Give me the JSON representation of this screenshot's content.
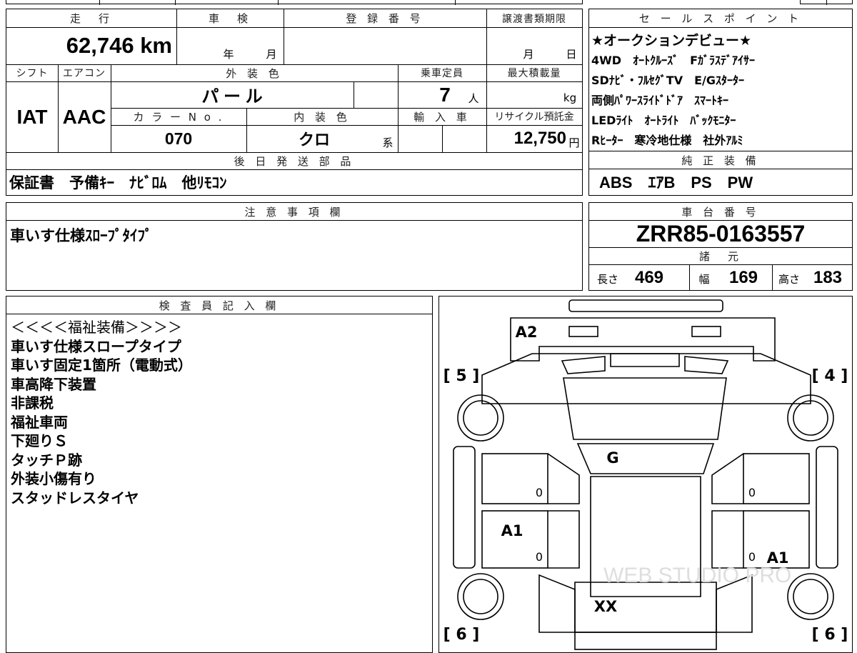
{
  "top_partial": "",
  "vehicle": {
    "mileage_header": "走　行",
    "mileage_value": "62,746 km",
    "inspection_header": "車　検",
    "inspection_year": "年",
    "inspection_month": "月",
    "registration_header": "登 録 番 号",
    "transfer_header": "譲渡書類期限",
    "transfer_month": "月",
    "transfer_day": "日",
    "shift_header": "シフト",
    "shift_value": "IAT",
    "ac_header": "エアコン",
    "ac_value": "AAC",
    "exterior_color_header": "外 装 色",
    "exterior_color_value": "パ ー ル",
    "capacity_header": "乗車定員",
    "capacity_value": "7",
    "capacity_unit": "人",
    "max_load_header": "最大積載量",
    "max_load_unit": "kg",
    "color_no_header": "カ ラ ー N o .",
    "color_no_value": "070",
    "interior_header": "内 装 色",
    "interior_value": "クロ",
    "interior_unit": "系",
    "import_header": "輸 入 車",
    "recycle_header": "リサイクル預託金",
    "recycle_value": "12,750",
    "recycle_unit": "円",
    "later_parts_header": "後 日 発 送 部 品",
    "later_parts_value": "保証書　予備ｷｰ　ﾅﾋﾞﾛﾑ　他ﾘﾓｺﾝ"
  },
  "sales_points": {
    "header": "セ ー ル ス ポ イ ン ト",
    "lines": [
      "★オークションデビュー★",
      "4WD　ｵｰﾄｸﾙｰｽﾞ　Fｶﾞﾗｽﾃﾞｱｲｻｰ",
      "SDﾅﾋﾞ・ﾌﾙｾｸﾞTV　E/Gｽﾀｰﾀｰ",
      "両側ﾊﾟﾜｰｽﾗｲﾄﾞﾄﾞｱ　ｽﾏｰﾄｷｰ",
      "LEDﾗｲﾄ　ｵｰﾄﾗｲﾄ　ﾊﾞｯｸﾓﾆﾀｰ",
      "Rﾋｰﾀｰ　寒冷地仕様　社外ｱﾙﾐ"
    ],
    "genuine_header": "純 正 装 備",
    "genuine_value": "ABS　ｴｱB　PS　PW"
  },
  "notes": {
    "header": "注 意 事 項 欄",
    "value": "車いす仕様ｽﾛｰﾌﾟﾀｲﾌﾟ"
  },
  "chassis": {
    "header": "車 台 番 号",
    "number": "ZRR85-0163557",
    "specs_header": "諸　元",
    "length_label": "長さ",
    "length_value": "469",
    "width_label": "幅",
    "width_value": "169",
    "height_label": "高さ",
    "height_value": "183"
  },
  "inspector": {
    "header": "検 査 員 記 入 欄",
    "lines": [
      "＜＜＜＜福祉装備＞＞＞＞",
      "車いす仕様スロープタイプ",
      "車いす固定1箇所（電動式）",
      "車高降下装置",
      "非課税",
      "福祉車両",
      "下廻りＳ",
      "タッチＰ跡",
      "外装小傷有り",
      "スタッドレスタイヤ"
    ]
  },
  "diagram": {
    "tire_front_left": "[ 5 ]",
    "tire_front_right": "[ 4 ]",
    "tire_rear_left": "[ 6 ]",
    "tire_rear_right": "[ 6 ]",
    "mark_bumper": "A2",
    "mark_roof": "G",
    "mark_left_side": "A1",
    "mark_right_side": "A1",
    "mark_rear": "XX",
    "zero_1": "0",
    "zero_2": "0",
    "zero_3": "0",
    "zero_4": "0",
    "watermark": "WEB STUDIO PRO"
  }
}
